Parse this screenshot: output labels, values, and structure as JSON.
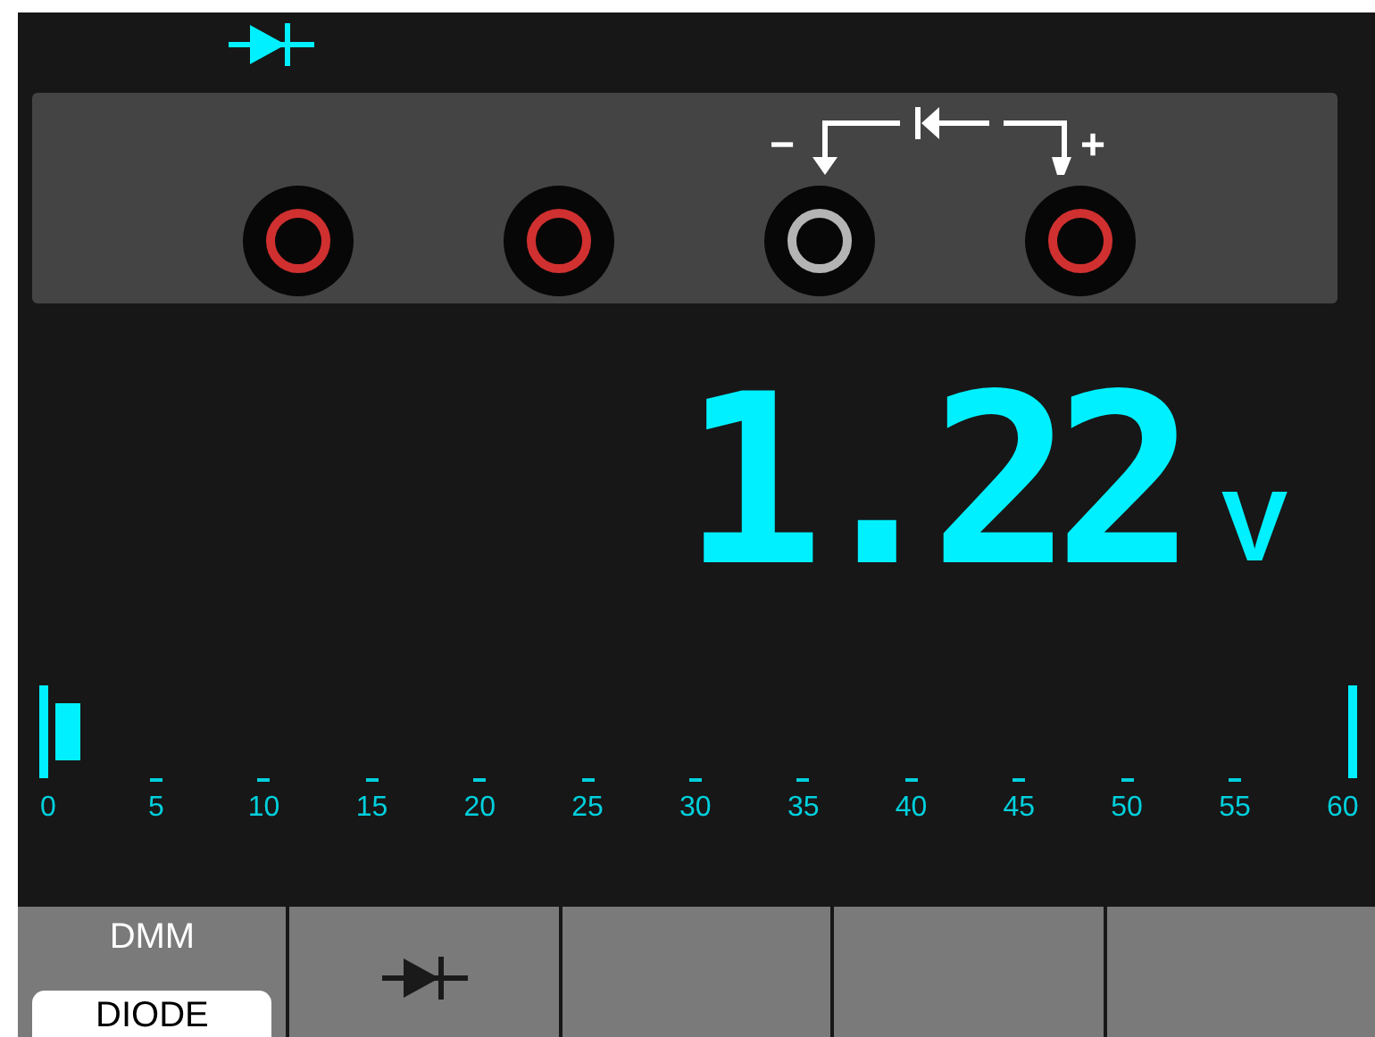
{
  "jacks": [
    {
      "color": "#d03030"
    },
    {
      "color": "#d03030"
    },
    {
      "color": "#b4b4b4"
    },
    {
      "color": "#d03030"
    }
  ],
  "connection": {
    "minus": "−",
    "plus": "+"
  },
  "reading": {
    "value": "1.22",
    "unit": "V"
  },
  "bargraph": {
    "level": 0.02,
    "scale": [
      "0",
      "5",
      "10",
      "15",
      "20",
      "25",
      "30",
      "35",
      "40",
      "45",
      "50",
      "55",
      "60"
    ]
  },
  "menu": [
    {
      "kind": "label",
      "label": "DMM",
      "value": "DIODE"
    },
    {
      "kind": "icon"
    },
    {
      "kind": "blank"
    },
    {
      "kind": "blank"
    },
    {
      "kind": "blank"
    }
  ]
}
